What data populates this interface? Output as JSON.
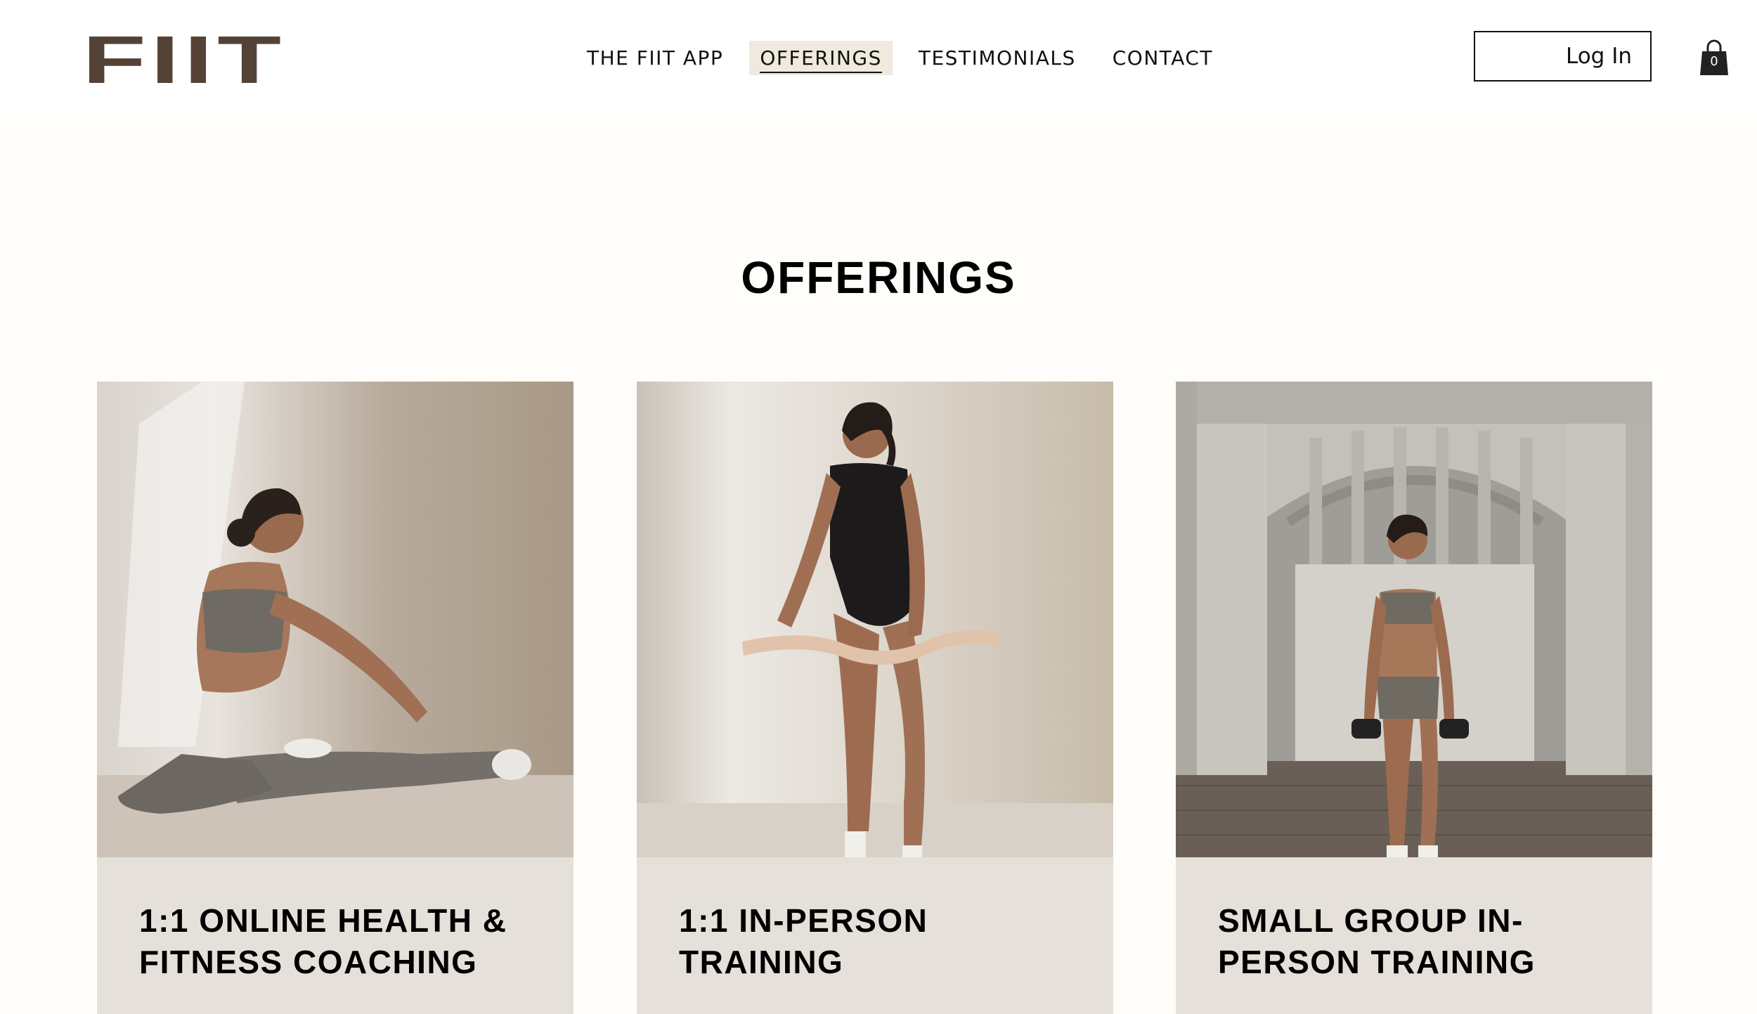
{
  "brand": {
    "logo": "FIIT"
  },
  "nav": {
    "items": [
      {
        "label": "THE FIIT APP",
        "active": false
      },
      {
        "label": "OFFERINGS",
        "active": true
      },
      {
        "label": "TESTIMONIALS",
        "active": false
      },
      {
        "label": "CONTACT",
        "active": false
      }
    ]
  },
  "header": {
    "login_label": "Log In",
    "cart_count": "0"
  },
  "page": {
    "title": "OFFERINGS"
  },
  "offerings": [
    {
      "title": "1:1 ONLINE HEALTH & FITNESS COACHING",
      "photo": "woman stretching seated"
    },
    {
      "title": "1:1 IN-PERSON TRAINING",
      "photo": "woman holding flexible bar"
    },
    {
      "title": "SMALL GROUP IN-PERSON TRAINING",
      "photo": "woman with dumbbells under bridge"
    }
  ],
  "colors": {
    "logo": "#554236",
    "page_bg": "#fefdf9",
    "card_bg": "#e5e0d9",
    "nav_active_bg": "#efeadd"
  }
}
